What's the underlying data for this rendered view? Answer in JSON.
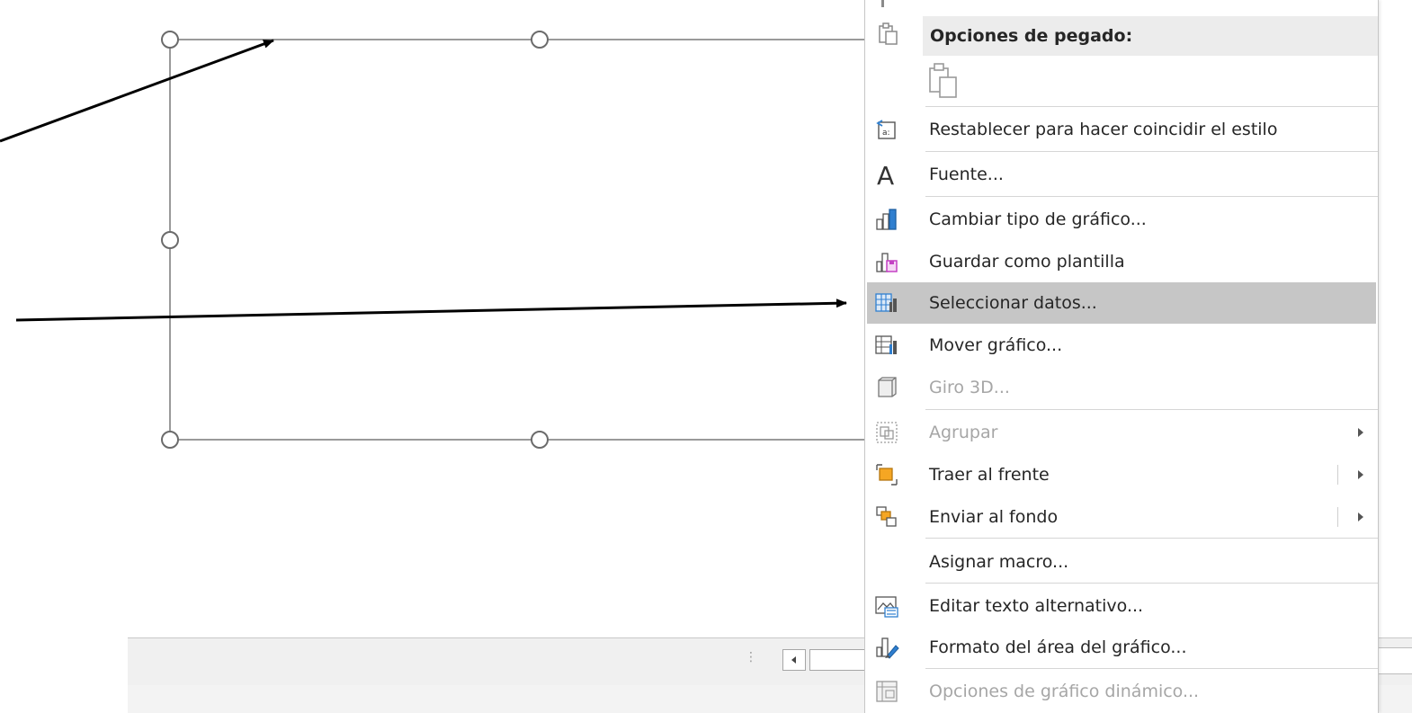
{
  "context_menu": {
    "paste_options_header": "Opciones de pegado:",
    "items": [
      {
        "id": "reset-style",
        "label": "Restablecer para hacer coincidir el estilo",
        "icon": "reset-style-icon",
        "enabled": true
      },
      {
        "id": "font",
        "label": "Fuente...",
        "icon": "font-a-icon",
        "enabled": true
      },
      {
        "id": "change-chart-type",
        "label": "Cambiar tipo de gráfico...",
        "icon": "bar-chart-icon",
        "enabled": true
      },
      {
        "id": "save-template",
        "label": "Guardar como plantilla",
        "icon": "save-template-icon",
        "enabled": true
      },
      {
        "id": "select-data",
        "label": "Seleccionar datos...",
        "icon": "select-data-icon",
        "enabled": true,
        "highlighted": true
      },
      {
        "id": "move-chart",
        "label": "Mover gráfico...",
        "icon": "move-chart-icon",
        "enabled": true
      },
      {
        "id": "rotate-3d",
        "label": "Giro 3D...",
        "icon": "cube-3d-icon",
        "enabled": false
      },
      {
        "id": "group",
        "label": "Agrupar",
        "icon": "group-icon",
        "enabled": false,
        "submenu": true
      },
      {
        "id": "bring-front",
        "label": "Traer al frente",
        "icon": "bring-front-icon",
        "enabled": true,
        "submenu": true
      },
      {
        "id": "send-back",
        "label": "Enviar al fondo",
        "icon": "send-back-icon",
        "enabled": true,
        "submenu": true
      },
      {
        "id": "assign-macro",
        "label": "Asignar macro...",
        "icon": "",
        "enabled": true
      },
      {
        "id": "alt-text",
        "label": "Editar texto alternativo...",
        "icon": "alt-text-icon",
        "enabled": true
      },
      {
        "id": "format-chart-area",
        "label": "Formato del área del gráfico...",
        "icon": "format-brush-icon",
        "enabled": true
      },
      {
        "id": "pivot-options",
        "label": "Opciones de gráfico dinámico...",
        "icon": "pivot-chart-icon",
        "enabled": false
      }
    ]
  },
  "colors": {
    "highlight": "#c6c6c6",
    "disabled_text": "#a6a6a6",
    "chart_icon_blue": "#2f7fd0",
    "bring_front_orange": "#f5a623",
    "save_template_magenta": "#c441c4"
  }
}
